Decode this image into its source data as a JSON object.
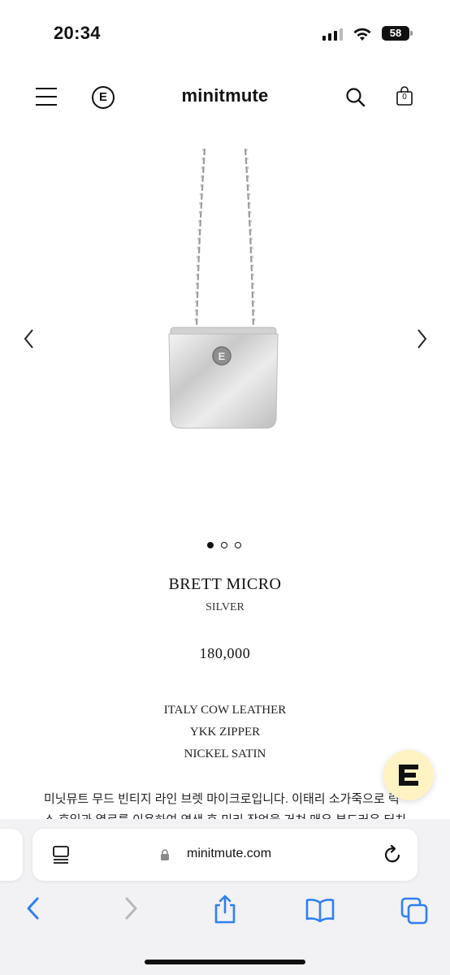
{
  "status_bar": {
    "time": "20:34",
    "battery": "58"
  },
  "header": {
    "title": "minitmute",
    "logo_letter": "E",
    "cart_count": "0"
  },
  "carousel": {
    "total": 3,
    "active": 0
  },
  "product": {
    "name": "BRETT MICRO",
    "color": "SILVER",
    "price": "180,000",
    "specs": [
      "ITALY COW LEATHER",
      "YKK ZIPPER",
      "NICKEL SATIN"
    ],
    "description_line1": "미닛뮤트 무드 빈티지 라인 브렛 마이크로입니다. 이태리 소가죽으로 럭",
    "description_line2": "스 후일과 열로를 이용하여 염색 후 미리 작업을 거쳐 매우 부드러운 터치"
  },
  "browser": {
    "url": "minitmute.com"
  },
  "colors": {
    "accent": "#2f7ff5",
    "chat_bg": "#fff3c4",
    "toolbar_bg": "#f2f2f4"
  },
  "icons": [
    "menu-icon",
    "logo-icon",
    "search-icon",
    "cart-icon",
    "chevron-left-icon",
    "chevron-right-icon",
    "chat-icon",
    "reader-icon",
    "lock-icon",
    "reload-icon",
    "back-icon",
    "forward-icon",
    "share-icon",
    "bookmarks-icon",
    "tabs-icon"
  ]
}
